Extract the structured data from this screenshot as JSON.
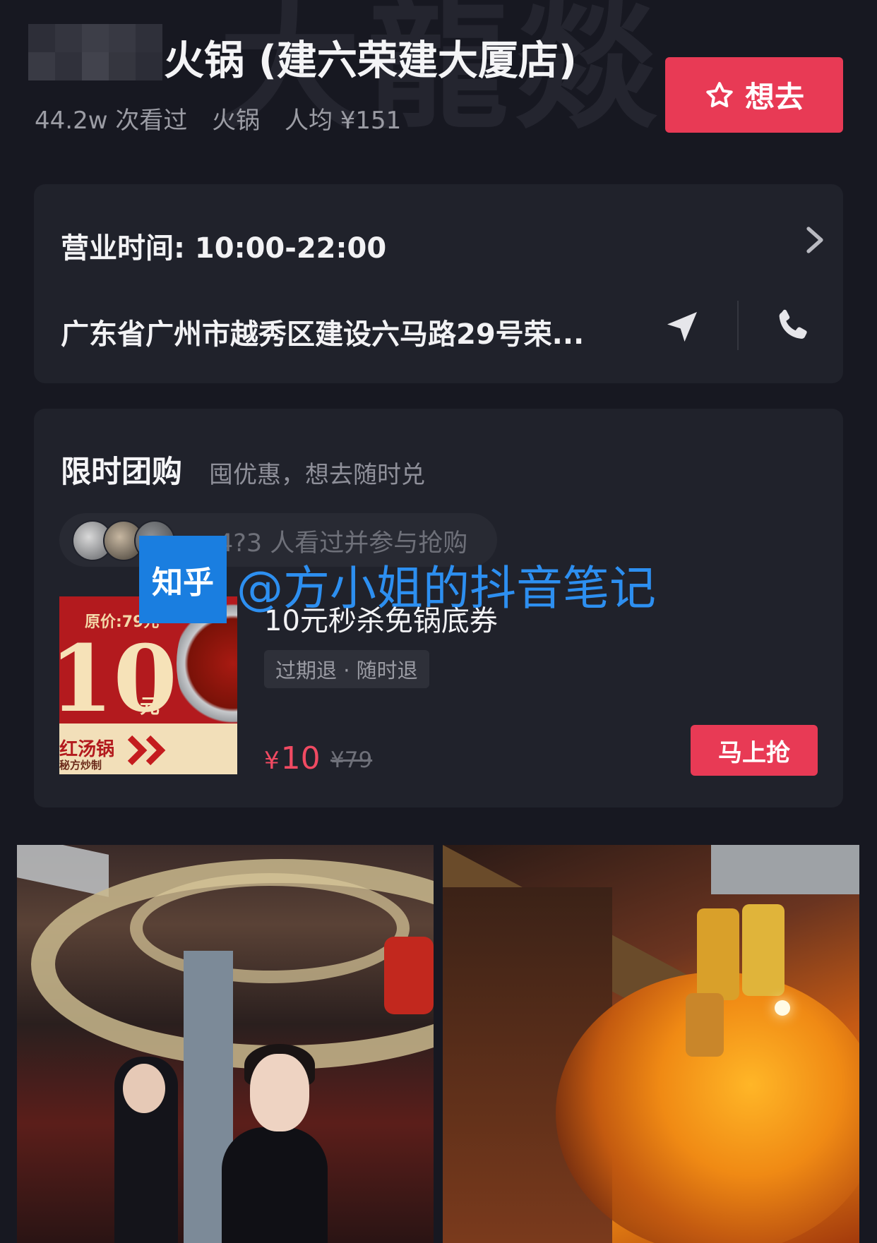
{
  "header": {
    "background_watermark": "大龍燚",
    "title": "火锅 (建六荣建大厦店)",
    "meta": [
      "44.2w 次看过",
      "火锅",
      "人均 ¥151"
    ],
    "want_button_label": "想去"
  },
  "info_card": {
    "hours": "营业时间: 10:00-22:00",
    "address": "广东省广州市越秀区建设六马路29号荣...",
    "icons": [
      "chevron-right-icon",
      "navigation-arrow-icon",
      "phone-icon"
    ]
  },
  "deal_card": {
    "title": "限时团购",
    "subtitle": "囤优惠，想去随时兑",
    "viewers": "4?3 人看过并参与抢购",
    "voucher_image": {
      "top_text": "原价:79元",
      "big_text": "10",
      "unit_text": "元",
      "band_text": "红汤锅",
      "band_small": "秘方炒制"
    },
    "item_name": "10元秒杀免锅底券",
    "tag": "过期退 · 随时退",
    "price_symbol": "¥",
    "price": "10",
    "original_price": "¥79",
    "buy_button_label": "马上抢"
  },
  "watermark": {
    "badge": "知乎",
    "text": "@方小姐的抖音笔记"
  },
  "colors": {
    "background": "#171821",
    "card": "#20222b",
    "accent": "#e83a55",
    "price": "#f04a62",
    "watermark_blue": "#2d8ff0"
  }
}
